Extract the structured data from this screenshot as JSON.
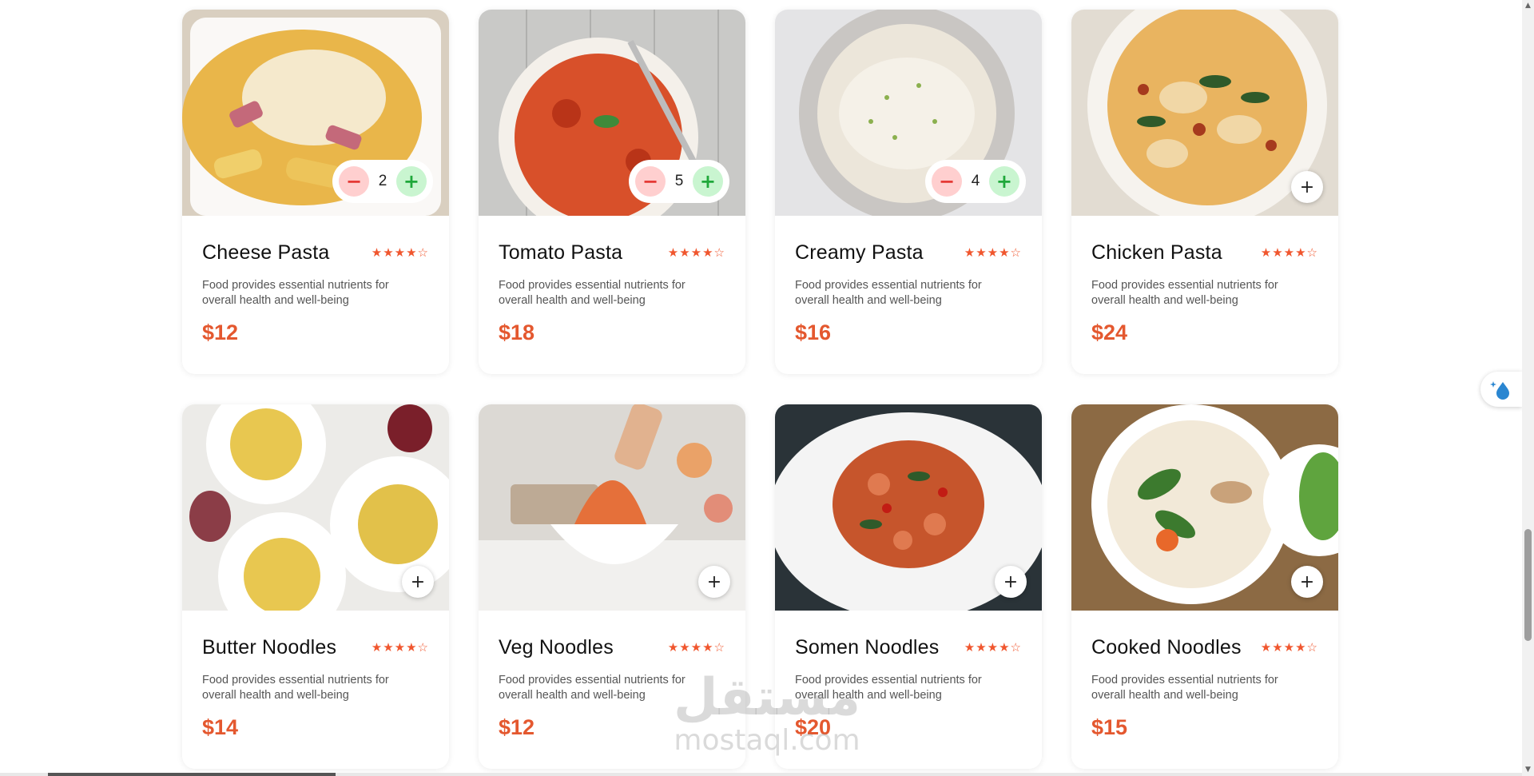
{
  "products": [
    {
      "name": "Cheese Pasta",
      "rating": "★★★★☆",
      "description": "Food provides essential nutrients for overall health and well-being",
      "price": "$12",
      "quantity": "2",
      "in_cart": true,
      "image": "cheese-pasta-image"
    },
    {
      "name": "Tomato Pasta",
      "rating": "★★★★☆",
      "description": "Food provides essential nutrients for overall health and well-being",
      "price": "$18",
      "quantity": "5",
      "in_cart": true,
      "image": "tomato-pasta-image"
    },
    {
      "name": "Creamy Pasta",
      "rating": "★★★★☆",
      "description": "Food provides essential nutrients for overall health and well-being",
      "price": "$16",
      "quantity": "4",
      "in_cart": true,
      "image": "creamy-pasta-image"
    },
    {
      "name": "Chicken Pasta",
      "rating": "★★★★☆",
      "description": "Food provides essential nutrients for overall health and well-being",
      "price": "$24",
      "in_cart": false,
      "image": "chicken-pasta-image"
    },
    {
      "name": "Butter Noodles",
      "rating": "★★★★☆",
      "description": "Food provides essential nutrients for overall health and well-being",
      "price": "$14",
      "in_cart": false,
      "image": "butter-noodles-image"
    },
    {
      "name": "Veg Noodles",
      "rating": "★★★★☆",
      "description": "Food provides essential nutrients for overall health and well-being",
      "price": "$12",
      "in_cart": false,
      "image": "veg-noodles-image"
    },
    {
      "name": "Somen Noodles",
      "rating": "★★★★☆",
      "description": "Food provides essential nutrients for overall health and well-being",
      "price": "$20",
      "in_cart": false,
      "image": "somen-noodles-image"
    },
    {
      "name": "Cooked Noodles",
      "rating": "★★★★☆",
      "description": "Food provides essential nutrients for overall health and well-being",
      "price": "$15",
      "in_cart": false,
      "image": "cooked-noodles-image"
    }
  ],
  "controls": {
    "add_symbol": "+",
    "minus_symbol": "−",
    "plus_symbol": "+"
  },
  "watermark": {
    "arabic": "مستقل",
    "latin": "mostaql.com"
  },
  "colors": {
    "accent": "#e4582f",
    "star": "#f0562e",
    "minus_bg": "#ffcfcf",
    "plus_bg": "#c9f5d0"
  },
  "icons": {
    "add": "plus-icon",
    "stars": "star-icon",
    "widget": "droplet-sparkle-icon"
  }
}
